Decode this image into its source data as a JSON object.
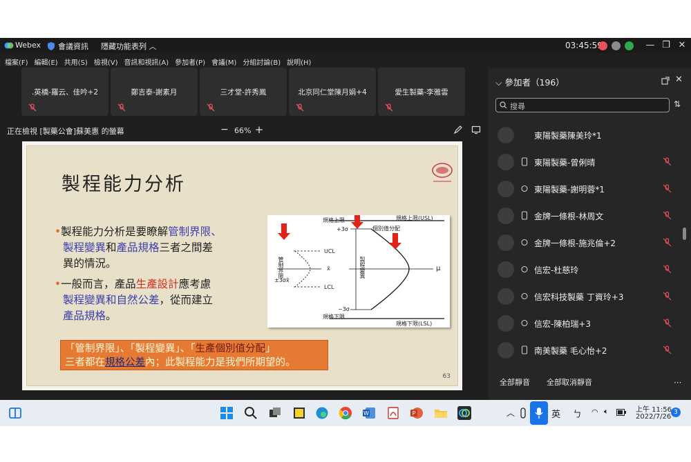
{
  "titlebar": {
    "app_name": "Webex",
    "meeting_info": "會議資訊",
    "hide_menu": "隱藏功能表列 ︿",
    "clock": "03:45:59"
  },
  "menu": [
    "檔案(F)",
    "編輯(E)",
    "共用(S)",
    "檢視(V)",
    "音訊和視訊(A)",
    "參加者(P)",
    "會議(M)",
    "分組討論(B)",
    "說明(H)"
  ],
  "thumbnails": [
    ".英橋-羅云、佳吟+2",
    "鄭吉泰-謝素月",
    "三才堂-許秀鳳",
    "北京同仁堂陳月娟+4",
    "愛生製藥-李雅雲"
  ],
  "viewbar": {
    "label": "正在檢視 [製藥公會]蘇美惠 的螢幕",
    "zoom_minus": "−",
    "zoom": "66%",
    "zoom_plus": "+"
  },
  "slide": {
    "title": "製程能力分析",
    "b1_l1_a": "製程能力分析是要瞭解",
    "b1_l1_b": "管制界限",
    "b1_l1_c": "、",
    "b1_l2_a": "製程變異",
    "b1_l2_b": "和",
    "b1_l2_c": "產品規格",
    "b1_l2_d": "三者之間差",
    "b1_l3": "異的情況。",
    "b2_l1_a": "一般而言，產品",
    "b2_l1_b": "生產設計",
    "b2_l1_c": "應考慮",
    "b2_l2_a": "製程變異和自然公差",
    "b2_l2_b": "，從而建立",
    "b2_l3_a": "產品規格",
    "b2_l3_b": "。",
    "box_l1_a": "「管制界限」、「製程變異」、「",
    "box_l1_b": "生產個別值分配",
    "box_l1_c": "」",
    "box_l2_a": "三者都在",
    "box_l2_b": "規格公差",
    "box_l2_c": "內；此製程能力是我們所期望的。",
    "page_number": "63",
    "diagram": {
      "usl_left": "規格上限",
      "usl_right": "規格上限(USL)",
      "plus3s": "+3σ",
      "dist": "個別值分配",
      "process_var": "製程變異",
      "ctrl_limit": "管制界限",
      "ucl": "UCL",
      "xbar": "x̄",
      "lcl": "LCL",
      "pm3s": "±3σx̄",
      "mu": "μ",
      "minus3s": "−3σ",
      "lsl_left": "規格下限",
      "lsl_right": "規格下限(LSL)"
    }
  },
  "panel": {
    "title": "參加者（196）",
    "search_placeholder": "搜尋",
    "participants": [
      {
        "name": "東陽製藥陳美玲*1",
        "device": "none",
        "muted": false
      },
      {
        "name": "東陽製藥-曾俐晴",
        "device": "phone",
        "muted": true
      },
      {
        "name": "東陽製藥-謝明蓉*1",
        "device": "sync",
        "muted": true
      },
      {
        "name": "金牌一條根-林周文",
        "device": "phone",
        "muted": true
      },
      {
        "name": "金牌一條根-施兆倫+2",
        "device": "sync",
        "muted": true
      },
      {
        "name": "信宏-杜慈玲",
        "device": "sync",
        "muted": true
      },
      {
        "name": "信宏科技製藥 丁資玲+3",
        "device": "sync",
        "muted": true
      },
      {
        "name": "信宏-陳柏瑞+3",
        "device": "sync",
        "muted": true
      },
      {
        "name": "南美製藥 毛心怡+2",
        "device": "phone",
        "muted": true
      }
    ],
    "mute_all": "全部靜音",
    "unmute_all": "全部取消靜音"
  },
  "taskbar": {
    "ime_lang": "英",
    "ime_mode": "ㄅ",
    "time": "上午 11:56",
    "date": "2022/7/26",
    "notifications": "3"
  },
  "colors": {
    "muted_red": "#e8505b",
    "accent_blue": "#3a3fb0",
    "slide_orange": "#e67a32"
  }
}
